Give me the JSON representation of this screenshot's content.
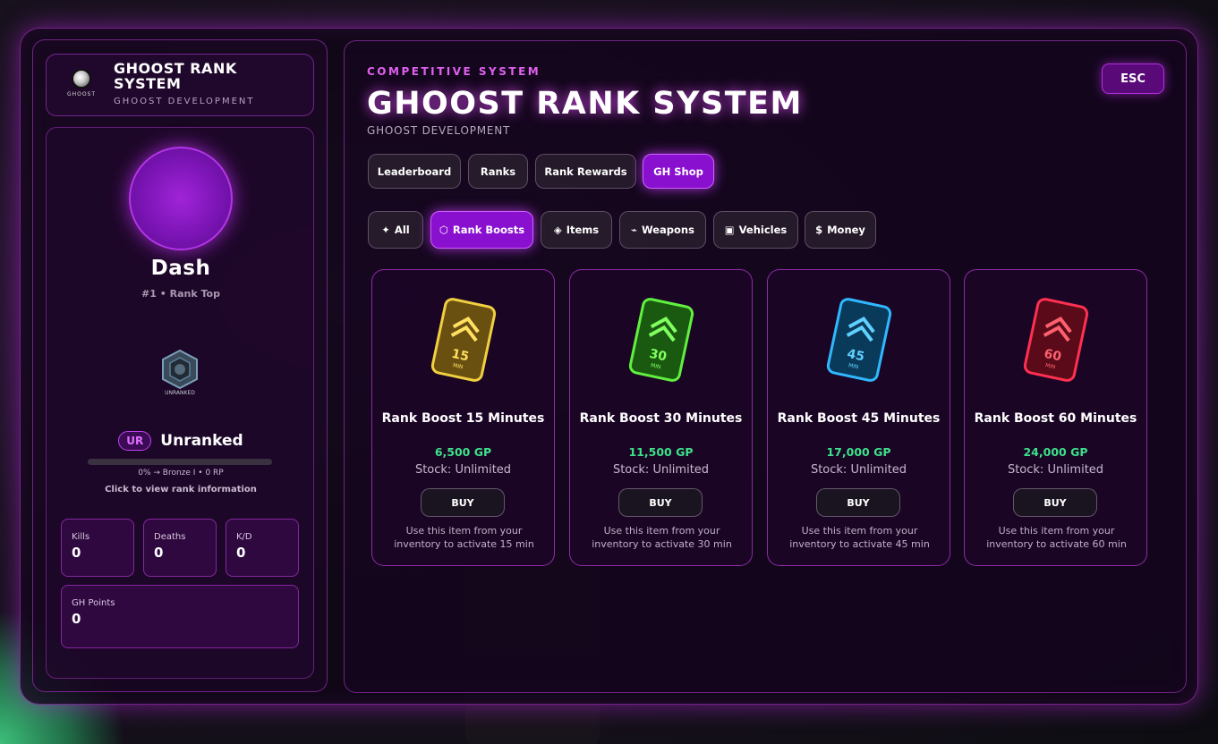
{
  "sidebar": {
    "brand_title": "GHOOST RANK SYSTEM",
    "brand_subtitle": "GHOOST DEVELOPMENT",
    "brand_logo_text": "GHOOST",
    "player_name": "Dash",
    "player_rank": "#1 • Rank Top",
    "emblem_text": "UNRANKED",
    "rank_badge": "UR",
    "rank_label": "Unranked",
    "rank_progress_percent": 0,
    "rank_progress_text": "0% → Bronze I • 0 RP",
    "rank_click_text": "Click to view rank information",
    "stats": [
      {
        "label": "Kills",
        "value": "0"
      },
      {
        "label": "Deaths",
        "value": "0"
      },
      {
        "label": "K/D",
        "value": "0"
      }
    ],
    "points": {
      "label": "GH Points",
      "value": "0"
    }
  },
  "header": {
    "kicker": "COMPETITIVE SYSTEM",
    "title": "GHOOST RANK SYSTEM",
    "subtitle": "GHOOST DEVELOPMENT",
    "esc_label": "ESC"
  },
  "tabs": [
    {
      "label": "Leaderboard",
      "active": false
    },
    {
      "label": "Ranks",
      "active": false
    },
    {
      "label": "Rank Rewards",
      "active": false
    },
    {
      "label": "GH Shop",
      "active": true
    }
  ],
  "filters": [
    {
      "icon": "✦",
      "label": "All",
      "active": false
    },
    {
      "icon": "⬡",
      "label": "Rank Boosts",
      "active": true
    },
    {
      "icon": "◈",
      "label": "Items",
      "active": false
    },
    {
      "icon": "⌁",
      "label": "Weapons",
      "active": false
    },
    {
      "icon": "▣",
      "label": "Vehicles",
      "active": false
    },
    {
      "icon": "$",
      "label": "Money",
      "active": false
    }
  ],
  "shop_items": [
    {
      "title": "Rank Boost 15 Minutes",
      "price": "6,500 GP",
      "stock": "Stock: Unlimited",
      "buy_label": "BUY",
      "description": "Use this item from your inventory to activate 15 min",
      "card_number": "15",
      "card_unit": "MIN",
      "color": "#e0c020"
    },
    {
      "title": "Rank Boost 30 Minutes",
      "price": "11,500 GP",
      "stock": "Stock: Unlimited",
      "buy_label": "BUY",
      "description": "Use this item from your inventory to activate 30 min",
      "card_number": "30",
      "card_unit": "MIN",
      "color": "#40e020"
    },
    {
      "title": "Rank Boost 45 Minutes",
      "price": "17,000 GP",
      "stock": "Stock: Unlimited",
      "buy_label": "BUY",
      "description": "Use this item from your inventory to activate 45 min",
      "card_number": "45",
      "card_unit": "MIN",
      "color": "#20a8f0"
    },
    {
      "title": "Rank Boost 60 Minutes",
      "price": "24,000 GP",
      "stock": "Stock: Unlimited",
      "buy_label": "BUY",
      "description": "Use this item from your inventory to activate 60 min",
      "card_number": "60",
      "card_unit": "MIN",
      "color": "#f02040"
    }
  ]
}
